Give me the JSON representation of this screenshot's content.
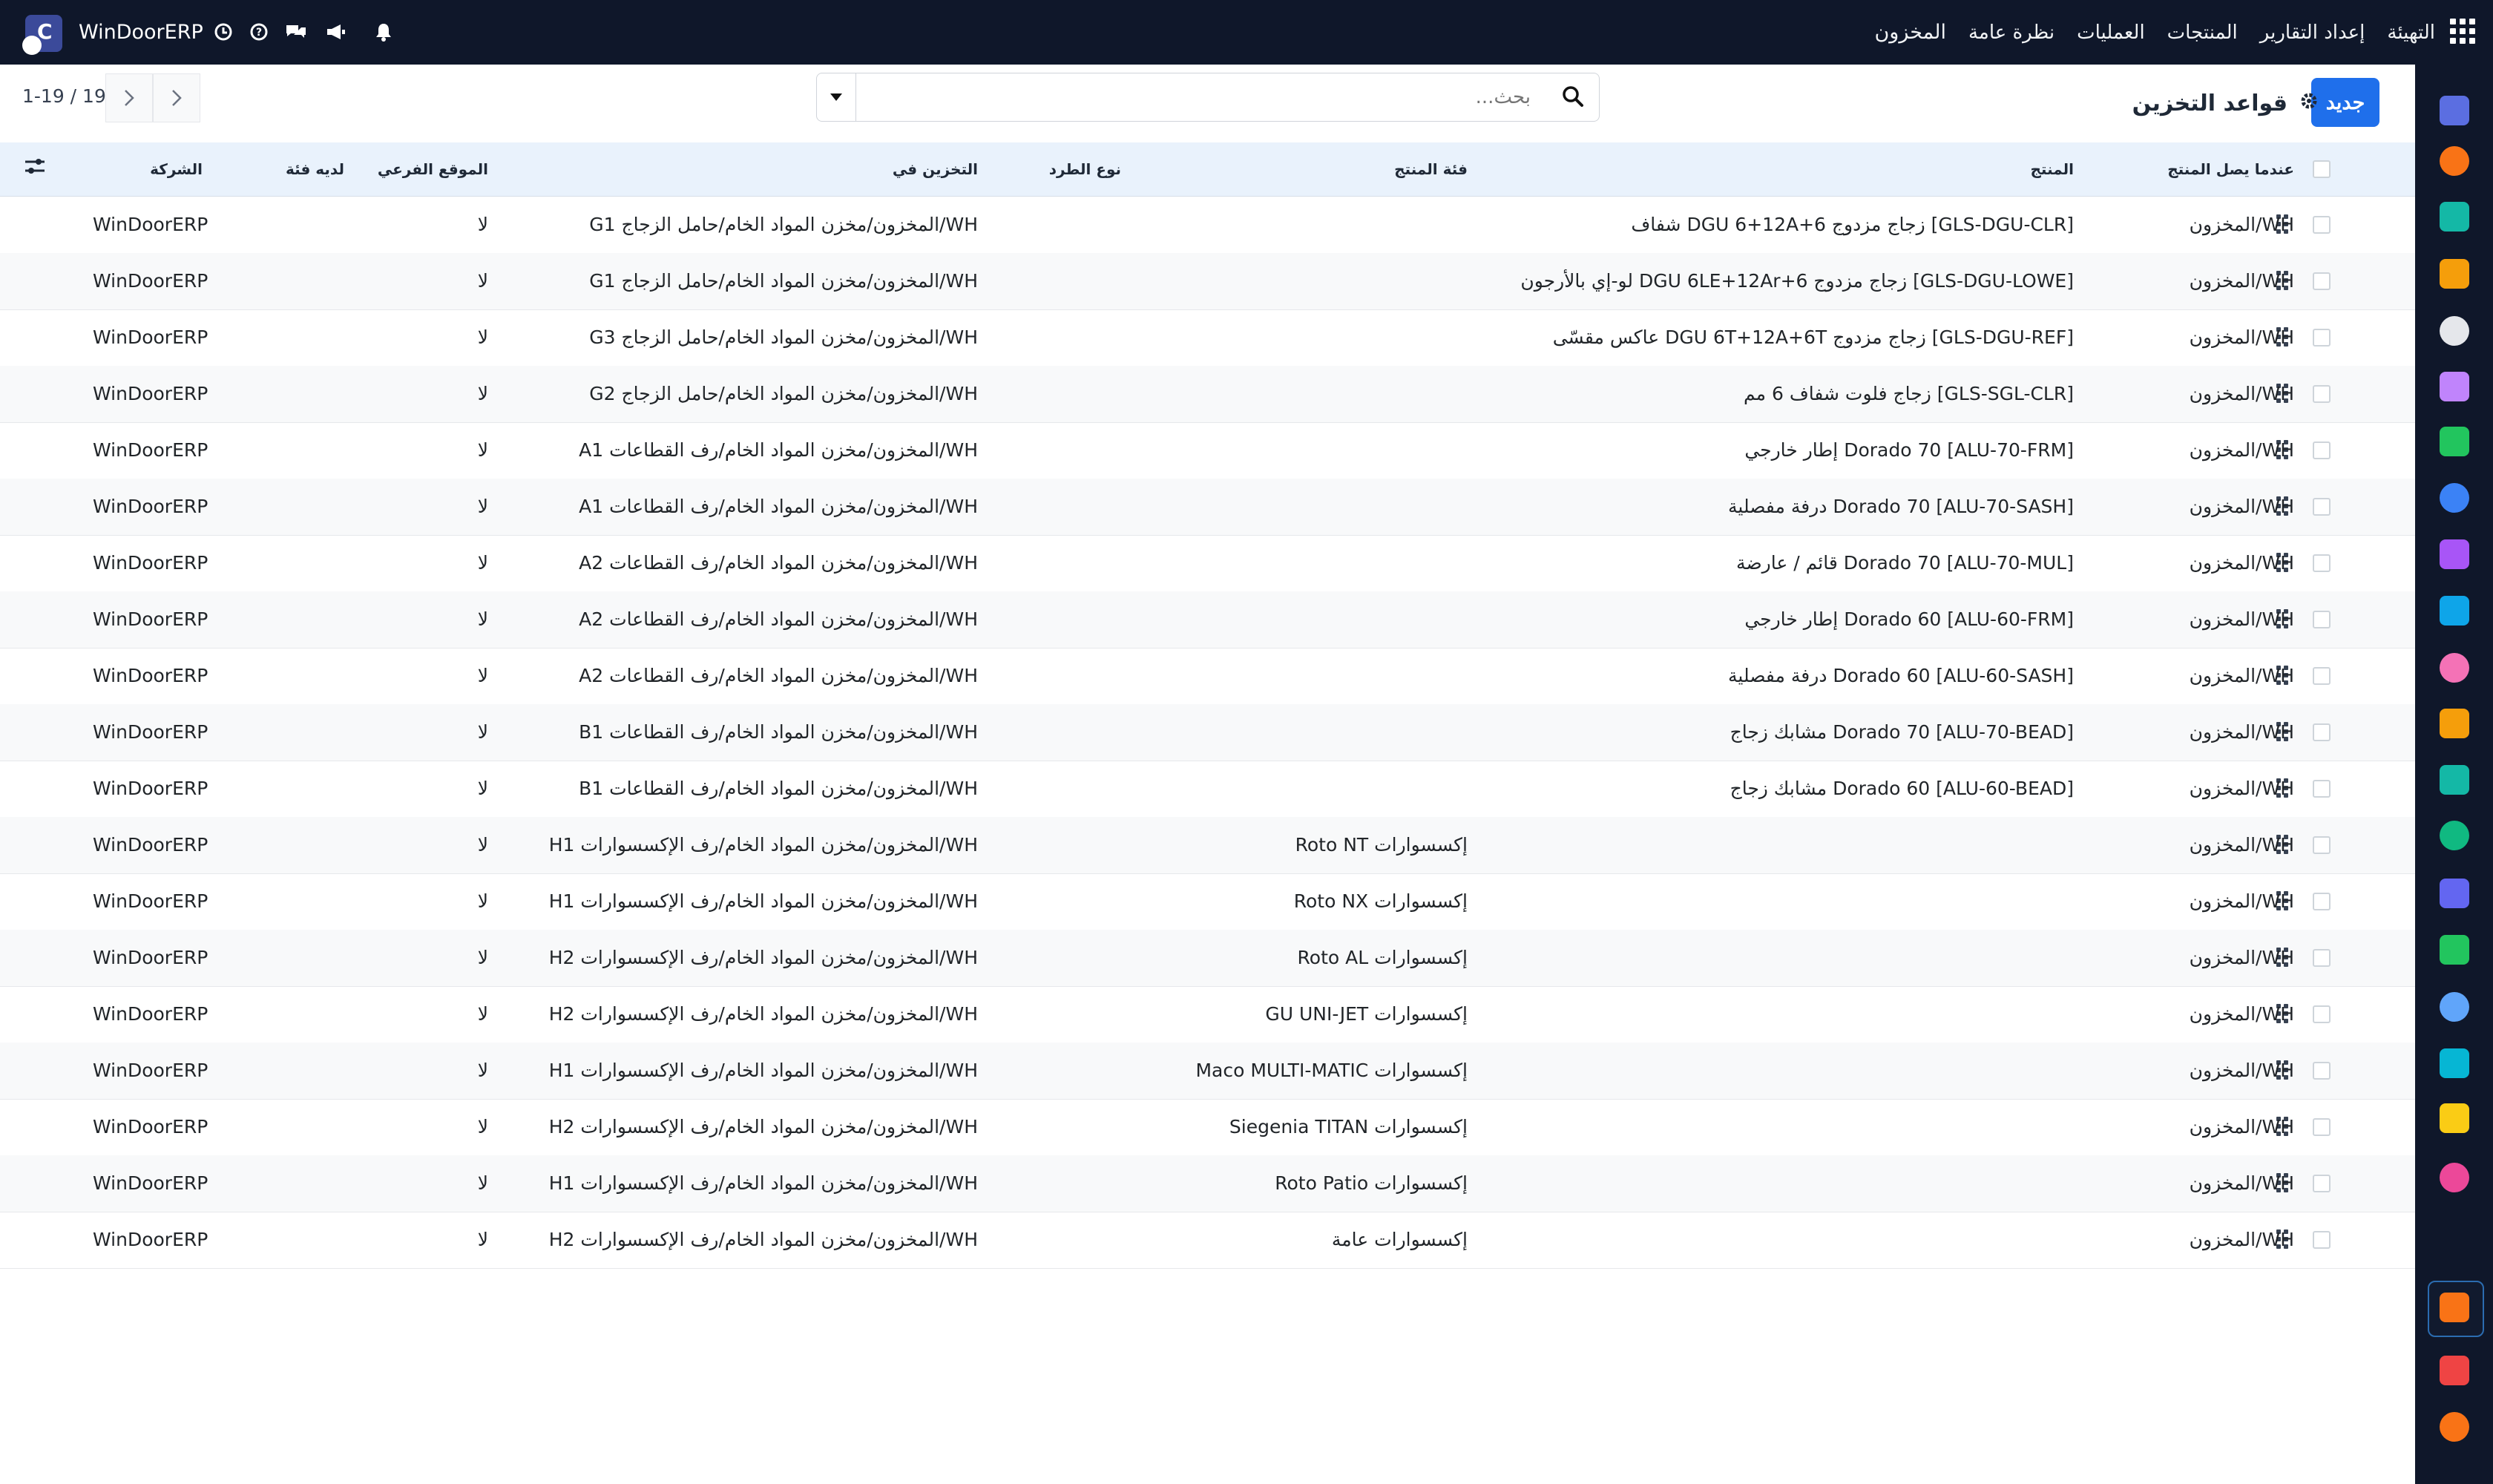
{
  "topbar": {
    "brand": "WinDoorERP",
    "menu": [
      "المخزون",
      "نظرة عامة",
      "العمليات",
      "المنتجات",
      "إعداد التقارير",
      "التهيئة"
    ],
    "brand_color": "#0f172a"
  },
  "control_panel": {
    "new_button": "جديد",
    "title": "قواعد التخزين",
    "search_placeholder": "بحث...",
    "pager": "1-19 / 19"
  },
  "table": {
    "columns": [
      "عندما يصل المنتج",
      "المنتج",
      "فئة المنتج",
      "نوع الطرد",
      "التخزين في",
      "الموقع الفرعي",
      "لديه فئة",
      "الشركة"
    ],
    "rows": [
      {
        "arrival": "WH/المخزون",
        "product": "[GLS-DGU-CLR] زجاج مزدوج DGU 6+12A+6 شفاف",
        "category": "",
        "package": "",
        "store_to": "WH/المخزون/مخزن المواد الخام/حامل الزجاج G1",
        "sublocation": "لا",
        "has_category": "",
        "company": "WinDoorERP"
      },
      {
        "arrival": "WH/المخزون",
        "product": "[GLS-DGU-LOWE] زجاج مزدوج DGU 6LE+12Ar+6 لو-إي بالأرجون",
        "category": "",
        "package": "",
        "store_to": "WH/المخزون/مخزن المواد الخام/حامل الزجاج G1",
        "sublocation": "لا",
        "has_category": "",
        "company": "WinDoorERP"
      },
      {
        "arrival": "WH/المخزون",
        "product": "[GLS-DGU-REF] زجاج مزدوج DGU 6T+12A+6T عاكس مقسّى",
        "category": "",
        "package": "",
        "store_to": "WH/المخزون/مخزن المواد الخام/حامل الزجاج G3",
        "sublocation": "لا",
        "has_category": "",
        "company": "WinDoorERP"
      },
      {
        "arrival": "WH/المخزون",
        "product": "[GLS-SGL-CLR] زجاج فلوت شفاف 6 مم",
        "category": "",
        "package": "",
        "store_to": "WH/المخزون/مخزن المواد الخام/حامل الزجاج G2",
        "sublocation": "لا",
        "has_category": "",
        "company": "WinDoorERP"
      },
      {
        "arrival": "WH/المخزون",
        "product": "[ALU-70-FRM] Dorado 70 إطار خارجي",
        "category": "",
        "package": "",
        "store_to": "WH/المخزون/مخزن المواد الخام/رف القطاعات A1",
        "sublocation": "لا",
        "has_category": "",
        "company": "WinDoorERP"
      },
      {
        "arrival": "WH/المخزون",
        "product": "[ALU-70-SASH] Dorado 70 درفة مفصلية",
        "category": "",
        "package": "",
        "store_to": "WH/المخزون/مخزن المواد الخام/رف القطاعات A1",
        "sublocation": "لا",
        "has_category": "",
        "company": "WinDoorERP"
      },
      {
        "arrival": "WH/المخزون",
        "product": "[ALU-70-MUL] Dorado 70 قائم / عارضة",
        "category": "",
        "package": "",
        "store_to": "WH/المخزون/مخزن المواد الخام/رف القطاعات A2",
        "sublocation": "لا",
        "has_category": "",
        "company": "WinDoorERP"
      },
      {
        "arrival": "WH/المخزون",
        "product": "[ALU-60-FRM] Dorado 60 إطار خارجي",
        "category": "",
        "package": "",
        "store_to": "WH/المخزون/مخزن المواد الخام/رف القطاعات A2",
        "sublocation": "لا",
        "has_category": "",
        "company": "WinDoorERP"
      },
      {
        "arrival": "WH/المخزون",
        "product": "[ALU-60-SASH] Dorado 60 درفة مفصلية",
        "category": "",
        "package": "",
        "store_to": "WH/المخزون/مخزن المواد الخام/رف القطاعات A2",
        "sublocation": "لا",
        "has_category": "",
        "company": "WinDoorERP"
      },
      {
        "arrival": "WH/المخزون",
        "product": "[ALU-70-BEAD] Dorado 70 مشابك زجاج",
        "category": "",
        "package": "",
        "store_to": "WH/المخزون/مخزن المواد الخام/رف القطاعات B1",
        "sublocation": "لا",
        "has_category": "",
        "company": "WinDoorERP"
      },
      {
        "arrival": "WH/المخزون",
        "product": "[ALU-60-BEAD] Dorado 60 مشابك زجاج",
        "category": "",
        "package": "",
        "store_to": "WH/المخزون/مخزن المواد الخام/رف القطاعات B1",
        "sublocation": "لا",
        "has_category": "",
        "company": "WinDoorERP"
      },
      {
        "arrival": "WH/المخزون",
        "product": "",
        "category": "إكسسوارات Roto NT",
        "package": "",
        "store_to": "WH/المخزون/مخزن المواد الخام/رف الإكسسوارات H1",
        "sublocation": "لا",
        "has_category": "",
        "company": "WinDoorERP"
      },
      {
        "arrival": "WH/المخزون",
        "product": "",
        "category": "إكسسوارات Roto NX",
        "package": "",
        "store_to": "WH/المخزون/مخزن المواد الخام/رف الإكسسوارات H1",
        "sublocation": "لا",
        "has_category": "",
        "company": "WinDoorERP"
      },
      {
        "arrival": "WH/المخزون",
        "product": "",
        "category": "إكسسوارات Roto AL",
        "package": "",
        "store_to": "WH/المخزون/مخزن المواد الخام/رف الإكسسوارات H2",
        "sublocation": "لا",
        "has_category": "",
        "company": "WinDoorERP"
      },
      {
        "arrival": "WH/المخزون",
        "product": "",
        "category": "إكسسوارات GU UNI-JET",
        "package": "",
        "store_to": "WH/المخزون/مخزن المواد الخام/رف الإكسسوارات H2",
        "sublocation": "لا",
        "has_category": "",
        "company": "WinDoorERP"
      },
      {
        "arrival": "WH/المخزون",
        "product": "",
        "category": "إكسسوارات Maco MULTI-MATIC",
        "package": "",
        "store_to": "WH/المخزون/مخزن المواد الخام/رف الإكسسوارات H1",
        "sublocation": "لا",
        "has_category": "",
        "company": "WinDoorERP"
      },
      {
        "arrival": "WH/المخزون",
        "product": "",
        "category": "إكسسوارات Siegenia TITAN",
        "package": "",
        "store_to": "WH/المخزون/مخزن المواد الخام/رف الإكسسوارات H2",
        "sublocation": "لا",
        "has_category": "",
        "company": "WinDoorERP"
      },
      {
        "arrival": "WH/المخزون",
        "product": "",
        "category": "إكسسوارات Roto Patio",
        "package": "",
        "store_to": "WH/المخزون/مخزن المواد الخام/رف الإكسسوارات H1",
        "sublocation": "لا",
        "has_category": "",
        "company": "WinDoorERP"
      },
      {
        "arrival": "WH/المخزون",
        "product": "",
        "category": "إكسسوارات عامة",
        "package": "",
        "store_to": "WH/المخزون/مخزن المواد الخام/رف الإكسسوارات H2",
        "sublocation": "لا",
        "has_category": "",
        "company": "WinDoorERP"
      }
    ]
  },
  "app_sidebar": {
    "apps": [
      {
        "name": "mail-app-icon",
        "color": "#5b6ee1"
      },
      {
        "name": "chat-app-icon",
        "color": "#f97316"
      },
      {
        "name": "sales-app-icon",
        "color": "#14b8a6"
      },
      {
        "name": "reporting-app-icon",
        "color": "#f59e0b"
      },
      {
        "name": "inventory-box-app-icon",
        "color": "#e5e7eb"
      },
      {
        "name": "contacts-app-icon",
        "color": "#c084fc"
      },
      {
        "name": "todo-app-icon",
        "color": "#22c55e"
      },
      {
        "name": "knowledge-app-icon",
        "color": "#3b82f6"
      },
      {
        "name": "package-app-icon",
        "color": "#a855f7"
      },
      {
        "name": "invoicing-app-icon",
        "color": "#0ea5e9"
      },
      {
        "name": "employees-app-icon",
        "color": "#f472b6"
      },
      {
        "name": "calendar-app-icon",
        "color": "#f59e0b"
      },
      {
        "name": "sign-app-icon",
        "color": "#14b8a6"
      },
      {
        "name": "recruitment-app-icon",
        "color": "#10b981"
      },
      {
        "name": "dashboard-app-icon",
        "color": "#6366f1"
      },
      {
        "name": "whatsapp-app-icon",
        "color": "#22c55e"
      },
      {
        "name": "timer-app-icon",
        "color": "#60a5fa"
      },
      {
        "name": "website-app-icon",
        "color": "#06b6d4"
      },
      {
        "name": "email-marketing-app-icon",
        "color": "#facc15"
      },
      {
        "name": "sms-app-icon",
        "color": "#ec4899"
      },
      {
        "name": "inventory-app-icon-active",
        "color": "#f97316"
      },
      {
        "name": "pie-app-icon",
        "color": "#ef4444"
      },
      {
        "name": "hexagon-app-icon",
        "color": "#f97316"
      }
    ]
  }
}
